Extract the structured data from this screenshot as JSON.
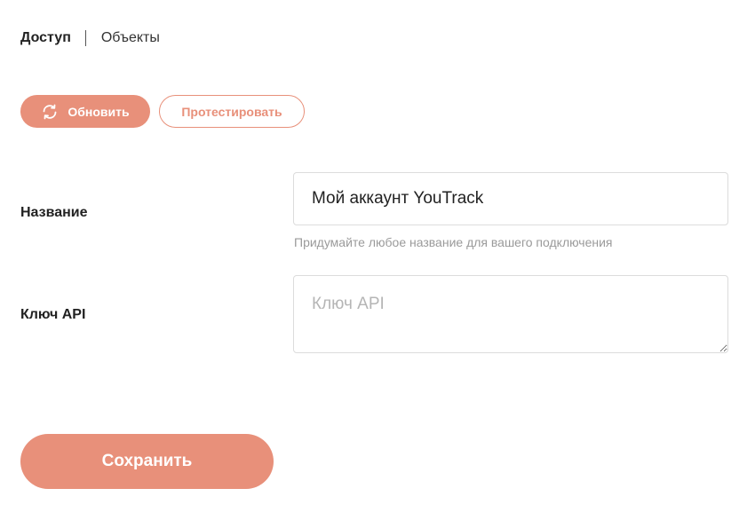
{
  "colors": {
    "accent": "#e8907a",
    "text": "#222222",
    "hint": "#9a9a9a",
    "border": "#dcdcdc"
  },
  "tabs": {
    "active": "Доступ",
    "second": "Объекты"
  },
  "toolbar": {
    "refresh_label": "Обновить",
    "refresh_icon": "refresh-icon",
    "test_label": "Протестировать"
  },
  "form": {
    "name": {
      "label": "Название",
      "value": "Мой аккаунт YouTrack",
      "hint": "Придумайте любое название для вашего подключения"
    },
    "api_key": {
      "label": "Ключ API",
      "placeholder": "Ключ API",
      "value": ""
    }
  },
  "save_label": "Сохранить"
}
